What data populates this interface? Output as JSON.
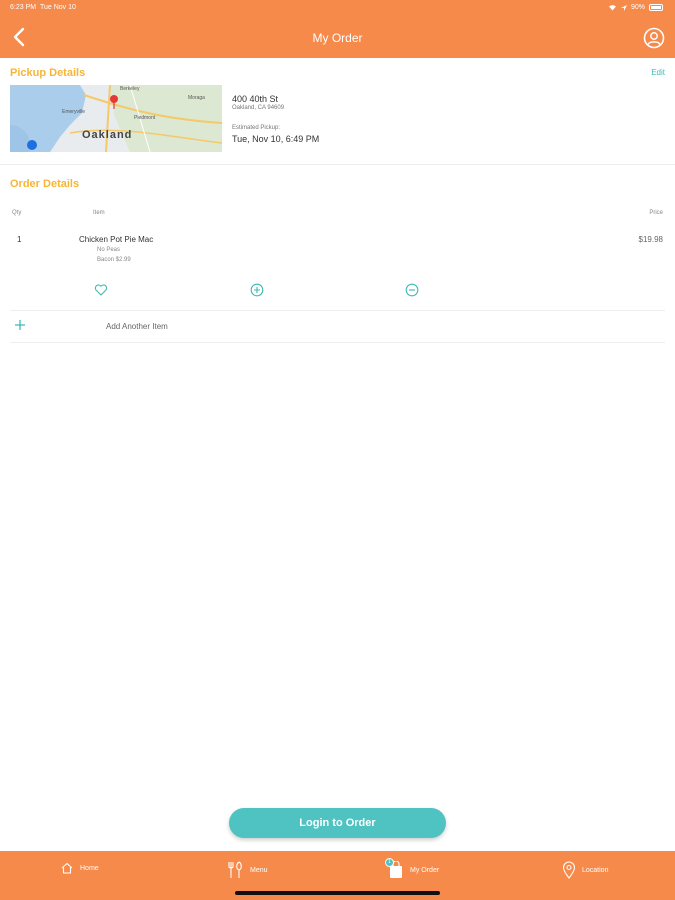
{
  "status_bar": {
    "time": "6:23 PM",
    "date": "Tue Nov 10",
    "battery": "90%"
  },
  "header": {
    "title": "My Order",
    "back_icon": "chevron-left-icon",
    "profile_icon": "user-circle-icon"
  },
  "pickup": {
    "title": "Pickup Details",
    "edit_label": "Edit",
    "map_label": "Oakland",
    "map_places": [
      "Moraga",
      "Piedmont",
      "Emeryville",
      "Berkeley"
    ],
    "street": "400 40th St",
    "city": "Oakland, CA 94609",
    "estimated_label": "Estimated Pickup:",
    "estimated_time": "Tue, Nov 10, 6:49 PM"
  },
  "order": {
    "title": "Order Details",
    "col_qty": "Qty",
    "col_item": "Item",
    "col_price": "Price",
    "items": [
      {
        "qty": "1",
        "name": "Chicken Pot Pie Mac",
        "mods": [
          "No Peas",
          "Bacon $2.99"
        ],
        "price": "$19.98"
      }
    ],
    "add_label": "Add Another Item"
  },
  "login_button": "Login to Order",
  "tabs": [
    {
      "label": "Home",
      "icon": "home-icon"
    },
    {
      "label": "Menu",
      "icon": "utensils-icon"
    },
    {
      "label": "My Order",
      "icon": "bag-icon",
      "badge": "1"
    },
    {
      "label": "Location",
      "icon": "map-pin-icon"
    }
  ],
  "colors": {
    "brand_orange": "#F58A4B",
    "accent_teal": "#4EC3C1",
    "section_yellow": "#F7B534"
  }
}
